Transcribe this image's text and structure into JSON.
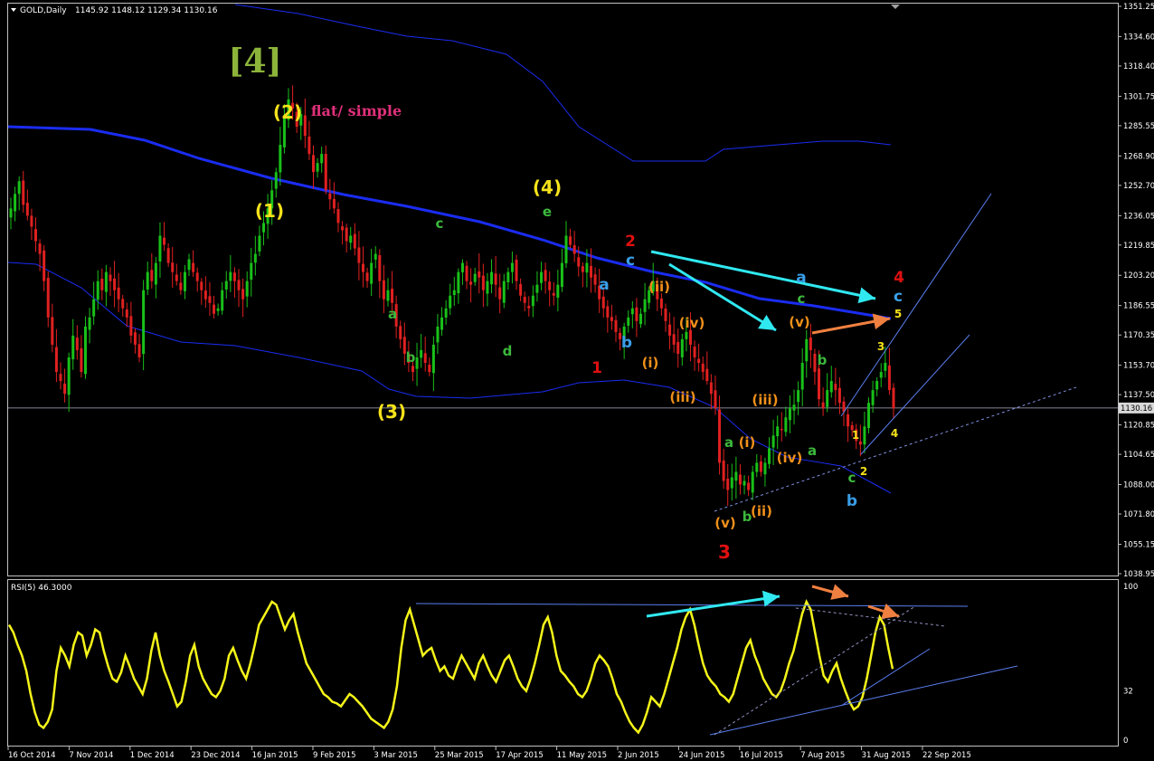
{
  "header": {
    "symbol": "GOLD,Daily",
    "ohlc": "1145.92 1148.12 1129.34 1130.16"
  },
  "rsi_header": "RSI(5) 46.3000",
  "price_axis": {
    "labels": [
      "1351.25",
      "1334.60",
      "1318.40",
      "1301.75",
      "1285.55",
      "1268.90",
      "1252.70",
      "1236.05",
      "1219.85",
      "1203.20",
      "1186.55",
      "1170.35",
      "1153.70",
      "1137.50",
      "1120.85",
      "1104.65",
      "1088.00",
      "1071.80",
      "1055.15",
      "1038.95"
    ],
    "current": "1130.16"
  },
  "rsi_axis": {
    "labels": [
      "100",
      "32",
      "0"
    ]
  },
  "time_axis": {
    "labels": [
      "16 Oct 2014",
      "7 Nov 2014",
      "1 Dec 2014",
      "23 Dec 2014",
      "16 Jan 2015",
      "9 Feb 2015",
      "3 Mar 2015",
      "25 Mar 2015",
      "17 Apr 2015",
      "11 May 2015",
      "2 Jun 2015",
      "24 Jun 2015",
      "16 Jul 2015",
      "7 Aug 2015",
      "31 Aug 2015",
      "22 Sep 2015"
    ]
  },
  "wave_labels": [
    {
      "text": "[4]",
      "color": "#8db43a"
    },
    {
      "text": "(2)",
      "color": "#f5e21a"
    },
    {
      "text": "flat/ simple",
      "color": "#e0307a"
    },
    {
      "text": "(1)",
      "color": "#f5e21a"
    },
    {
      "text": "(4)",
      "color": "#f5e21a"
    },
    {
      "text": "e",
      "color": "#3cb83c"
    },
    {
      "text": "c",
      "color": "#3cb83c"
    },
    {
      "text": "a",
      "color": "#3cb83c"
    },
    {
      "text": "b",
      "color": "#3cb83c"
    },
    {
      "text": "d",
      "color": "#3cb83c"
    },
    {
      "text": "(3)",
      "color": "#f5e21a"
    },
    {
      "text": "2",
      "color": "#e01010"
    },
    {
      "text": "c",
      "color": "#3a9ee8"
    },
    {
      "text": "a",
      "color": "#3a9ee8"
    },
    {
      "text": "b",
      "color": "#3a9ee8"
    },
    {
      "text": "1",
      "color": "#e01010"
    },
    {
      "text": "(ii)",
      "color": "#f0901a"
    },
    {
      "text": "(iv)",
      "color": "#f0901a"
    },
    {
      "text": "(i)",
      "color": "#f0901a"
    },
    {
      "text": "(iii)",
      "color": "#f0901a"
    },
    {
      "text": "a",
      "color": "#3a9ee8"
    },
    {
      "text": "c",
      "color": "#3cb83c"
    },
    {
      "text": "4",
      "color": "#e01010"
    },
    {
      "text": "c",
      "color": "#3a9ee8"
    },
    {
      "text": "5",
      "color": "#f5e21a"
    },
    {
      "text": "(v)",
      "color": "#f0901a"
    },
    {
      "text": "b",
      "color": "#3cb83c"
    },
    {
      "text": "3",
      "color": "#f5e21a"
    },
    {
      "text": "(iii)",
      "color": "#f0901a"
    },
    {
      "text": "a",
      "color": "#3cb83c"
    },
    {
      "text": "(i)",
      "color": "#f0901a"
    },
    {
      "text": "(iv)",
      "color": "#f0901a"
    },
    {
      "text": "a",
      "color": "#3cb83c"
    },
    {
      "text": "1",
      "color": "#f5e21a"
    },
    {
      "text": "4",
      "color": "#f5e21a"
    },
    {
      "text": "2",
      "color": "#f5e21a"
    },
    {
      "text": "c",
      "color": "#3cb83c"
    },
    {
      "text": "b",
      "color": "#3a9ee8"
    },
    {
      "text": "b",
      "color": "#3cb83c"
    },
    {
      "text": "(ii)",
      "color": "#f0901a"
    },
    {
      "text": "(v)",
      "color": "#f0901a"
    },
    {
      "text": "3",
      "color": "#e01010"
    }
  ],
  "colors": {
    "background": "#000000",
    "bull_candle": "#19c019",
    "bear_candle": "#e02020",
    "ma_band": "#1a2cf0",
    "trendline": "#5a7ef0",
    "rsi_line": "#f5f51a",
    "cyan_arrow": "#30e8f0",
    "orange_arrow": "#f08040",
    "axis_text": "#ffffff",
    "grid_frame": "#c0c0c0"
  },
  "chart_data": {
    "type": "candlestick",
    "instrument": "GOLD",
    "timeframe": "Daily",
    "ylim": [
      1038.95,
      1351.25
    ],
    "closes": [
      1240,
      1248,
      1255,
      1242,
      1236,
      1230,
      1222,
      1215,
      1200,
      1180,
      1165,
      1150,
      1145,
      1138,
      1158,
      1170,
      1162,
      1150,
      1175,
      1180,
      1190,
      1200,
      1195,
      1205,
      1200,
      1195,
      1190,
      1185,
      1180,
      1170,
      1165,
      1158,
      1195,
      1205,
      1200,
      1210,
      1225,
      1220,
      1210,
      1205,
      1200,
      1195,
      1205,
      1212,
      1205,
      1200,
      1195,
      1190,
      1188,
      1182,
      1185,
      1195,
      1200,
      1205,
      1200,
      1195,
      1190,
      1200,
      1210,
      1215,
      1225,
      1232,
      1240,
      1250,
      1260,
      1275,
      1290,
      1300,
      1295,
      1285,
      1292,
      1280,
      1270,
      1260,
      1265,
      1270,
      1250,
      1245,
      1240,
      1232,
      1228,
      1222,
      1225,
      1218,
      1210,
      1205,
      1200,
      1210,
      1215,
      1200,
      1190,
      1195,
      1188,
      1175,
      1168,
      1160,
      1155,
      1150,
      1158,
      1162,
      1155,
      1150,
      1165,
      1175,
      1180,
      1185,
      1192,
      1195,
      1205,
      1210,
      1200,
      1198,
      1204,
      1202,
      1195,
      1200,
      1205,
      1198,
      1190,
      1200,
      1205,
      1210,
      1200,
      1192,
      1188,
      1185,
      1192,
      1198,
      1205,
      1200,
      1195,
      1192,
      1198,
      1210,
      1225,
      1220,
      1215,
      1208,
      1205,
      1210,
      1202,
      1198,
      1190,
      1185,
      1180,
      1178,
      1172,
      1168,
      1175,
      1180,
      1185,
      1178,
      1182,
      1190,
      1195,
      1200,
      1190,
      1185,
      1178,
      1170,
      1165,
      1160,
      1168,
      1172,
      1165,
      1158,
      1155,
      1150,
      1145,
      1138,
      1130,
      1100,
      1090,
      1085,
      1092,
      1095,
      1088,
      1090,
      1085,
      1095,
      1100,
      1095,
      1100,
      1108,
      1115,
      1120,
      1118,
      1125,
      1130,
      1132,
      1140,
      1155,
      1168,
      1162,
      1150,
      1135,
      1130,
      1140,
      1145,
      1140,
      1133,
      1128,
      1120,
      1118,
      1112,
      1110,
      1120,
      1133,
      1140,
      1145,
      1150,
      1155,
      1140,
      1130
    ],
    "rsi": {
      "name": "RSI(5)",
      "last": 46.3,
      "ylim": [
        0,
        100
      ],
      "levels_shown": [
        100,
        32,
        0
      ],
      "values": [
        75,
        70,
        62,
        55,
        45,
        30,
        18,
        10,
        8,
        12,
        20,
        45,
        60,
        55,
        48,
        62,
        70,
        68,
        55,
        62,
        72,
        70,
        58,
        48,
        40,
        38,
        44,
        55,
        48,
        40,
        35,
        30,
        40,
        58,
        70,
        55,
        45,
        38,
        30,
        22,
        25,
        38,
        55,
        62,
        48,
        40,
        35,
        30,
        28,
        32,
        40,
        55,
        60,
        52,
        45,
        40,
        50,
        62,
        75,
        80,
        85,
        90,
        88,
        80,
        72,
        78,
        82,
        70,
        60,
        50,
        45,
        40,
        35,
        30,
        28,
        25,
        24,
        22,
        26,
        30,
        28,
        25,
        22,
        18,
        14,
        12,
        10,
        8,
        12,
        20,
        35,
        60,
        78,
        85,
        75,
        65,
        55,
        58,
        60,
        52,
        45,
        48,
        42,
        40,
        48,
        55,
        50,
        45,
        40,
        50,
        55,
        48,
        42,
        38,
        45,
        52,
        55,
        48,
        40,
        35,
        32,
        40,
        50,
        62,
        75,
        80,
        70,
        55,
        45,
        42,
        38,
        35,
        30,
        28,
        32,
        40,
        50,
        55,
        52,
        48,
        40,
        30,
        25,
        18,
        12,
        8,
        5,
        10,
        18,
        28,
        25,
        22,
        30,
        40,
        50,
        60,
        72,
        80,
        85,
        75,
        62,
        50,
        42,
        38,
        35,
        30,
        28,
        25,
        30,
        40,
        50,
        60,
        65,
        55,
        48,
        40,
        35,
        30,
        28,
        32,
        40,
        50,
        58,
        70,
        82,
        90,
        85,
        70,
        55,
        42,
        38,
        45,
        50,
        40,
        32,
        25,
        20,
        22,
        28,
        40,
        55,
        70,
        80,
        75,
        60,
        46.3
      ]
    }
  }
}
